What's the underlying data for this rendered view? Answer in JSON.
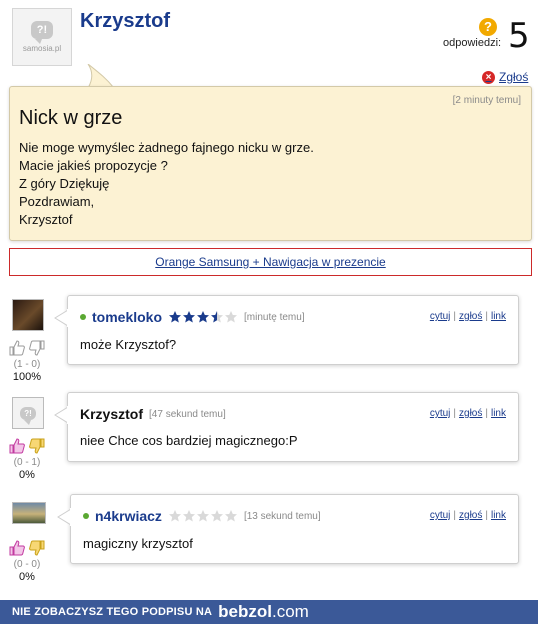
{
  "question": {
    "author": "Krzysztof",
    "answers_label": "odpowiedzi:",
    "answers_count": "5",
    "report_label": "Zgłoś",
    "time": "[2 minuty temu]",
    "title": "Nick w grze",
    "body_lines": [
      "Nie moge wymyślec żadnego fajnego nicku w grze.",
      "Macie jakieś propozycje ?",
      "Z góry Dziękuję",
      "Pozdrawiam,",
      "Krzysztof"
    ],
    "logo_text": "samosia.pl",
    "logo_mark": "?!"
  },
  "ad": {
    "label": "Orange Samsung + Nawigacja w prezencie"
  },
  "links": {
    "quote": "cytuj",
    "report": "zgłoś",
    "link": "link",
    "sep": "|"
  },
  "comments": [
    {
      "user": "tomekloko",
      "online": true,
      "stars": 3.5,
      "time": "[minutę temu]",
      "text": "może Krzysztof?",
      "score": "(1 - 0)",
      "pct": "100%"
    },
    {
      "user": "Krzysztof",
      "online": false,
      "stars": null,
      "time": "[47 sekund temu]",
      "text": "niee Chce cos bardziej magicznego:P",
      "score": "(0 - 1)",
      "pct": "0%"
    },
    {
      "user": "n4krwiacz",
      "online": true,
      "stars": 0,
      "time": "[13 sekund temu]",
      "text": "magiczny krzysztof",
      "score": "(0 - 0)",
      "pct": "0%"
    }
  ],
  "footer": {
    "text": "NIE ZOBACZYSZ TEGO PODPISU NA",
    "brand": "bebzol",
    "tld": ".com"
  },
  "colors": {
    "link": "#1a3b8c",
    "bubble": "#fcf2d3",
    "star": "#1a3b8c",
    "footer": "#3b5998"
  }
}
